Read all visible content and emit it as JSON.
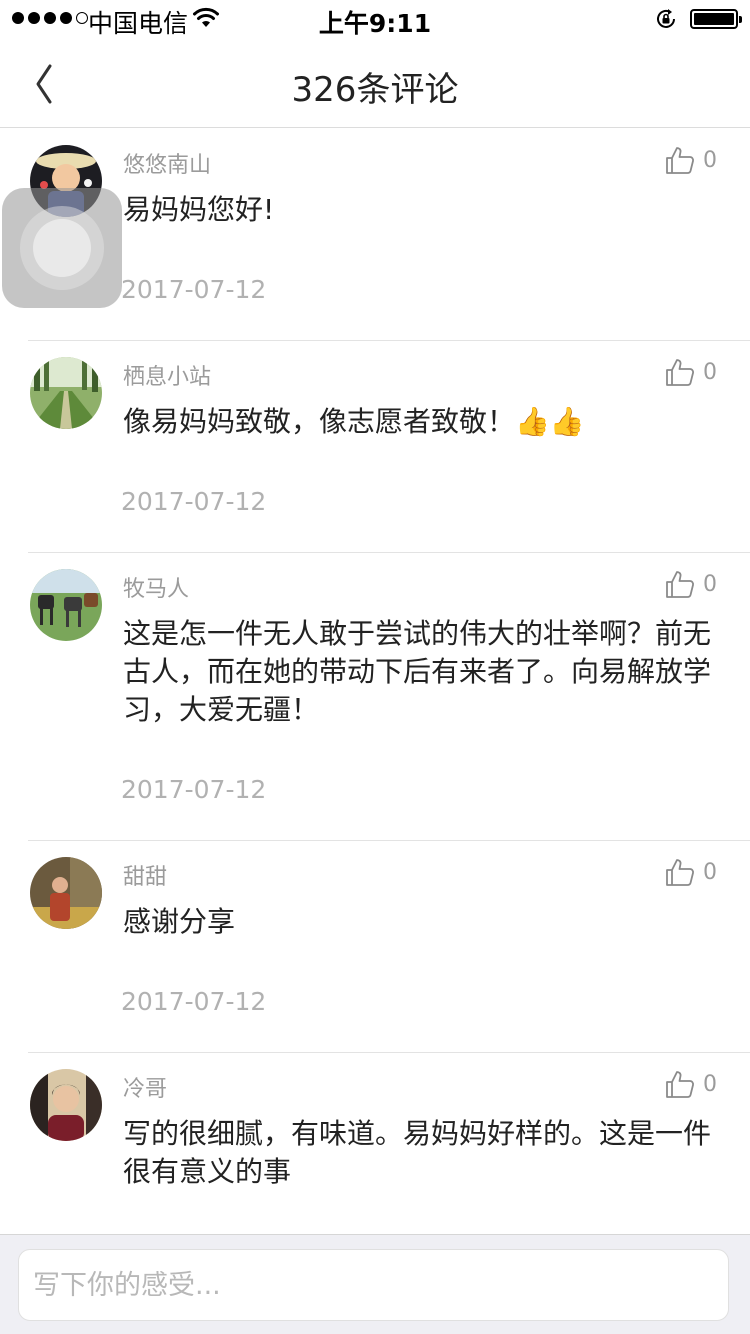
{
  "status_bar": {
    "carrier": "中国电信",
    "time": "上午9:11",
    "signal_bars_filled": 4,
    "signal_bars_total": 5,
    "battery_level": 1.0
  },
  "nav": {
    "title": "326条评论",
    "back_icon": "chevron-left-icon"
  },
  "comments": [
    {
      "username": "悠悠南山",
      "text": "易妈妈您好!",
      "date": "2017-07-12",
      "likes": "0"
    },
    {
      "username": "栖息小站",
      "text": "像易妈妈致敬，像志愿者致敬！👍👍",
      "date": "2017-07-12",
      "likes": "0"
    },
    {
      "username": "牧马人",
      "text": "这是怎一件无人敢于尝试的伟大的壮举啊？前无古人，而在她的带动下后有来者了。向易解放学习，大爱无疆！",
      "date": "2017-07-12",
      "likes": "0"
    },
    {
      "username": "甜甜",
      "text": "感谢分享",
      "date": "2017-07-12",
      "likes": "0"
    },
    {
      "username": "冷哥",
      "text": "写的很细腻，有味道。易妈妈好样的。这是一件很有意义的事",
      "likes": "0"
    }
  ],
  "input": {
    "placeholder": "写下你的感受..."
  },
  "icons": {
    "like": "thumbs-up-icon",
    "wifi": "wifi-icon",
    "rotation_lock": "rotation-lock-icon",
    "battery": "battery-icon"
  },
  "colors": {
    "meta_text": "#9b9b9b",
    "date_text": "#b1b1b1",
    "divider": "#e3e3e3",
    "input_bar_bg": "#efeff4"
  }
}
